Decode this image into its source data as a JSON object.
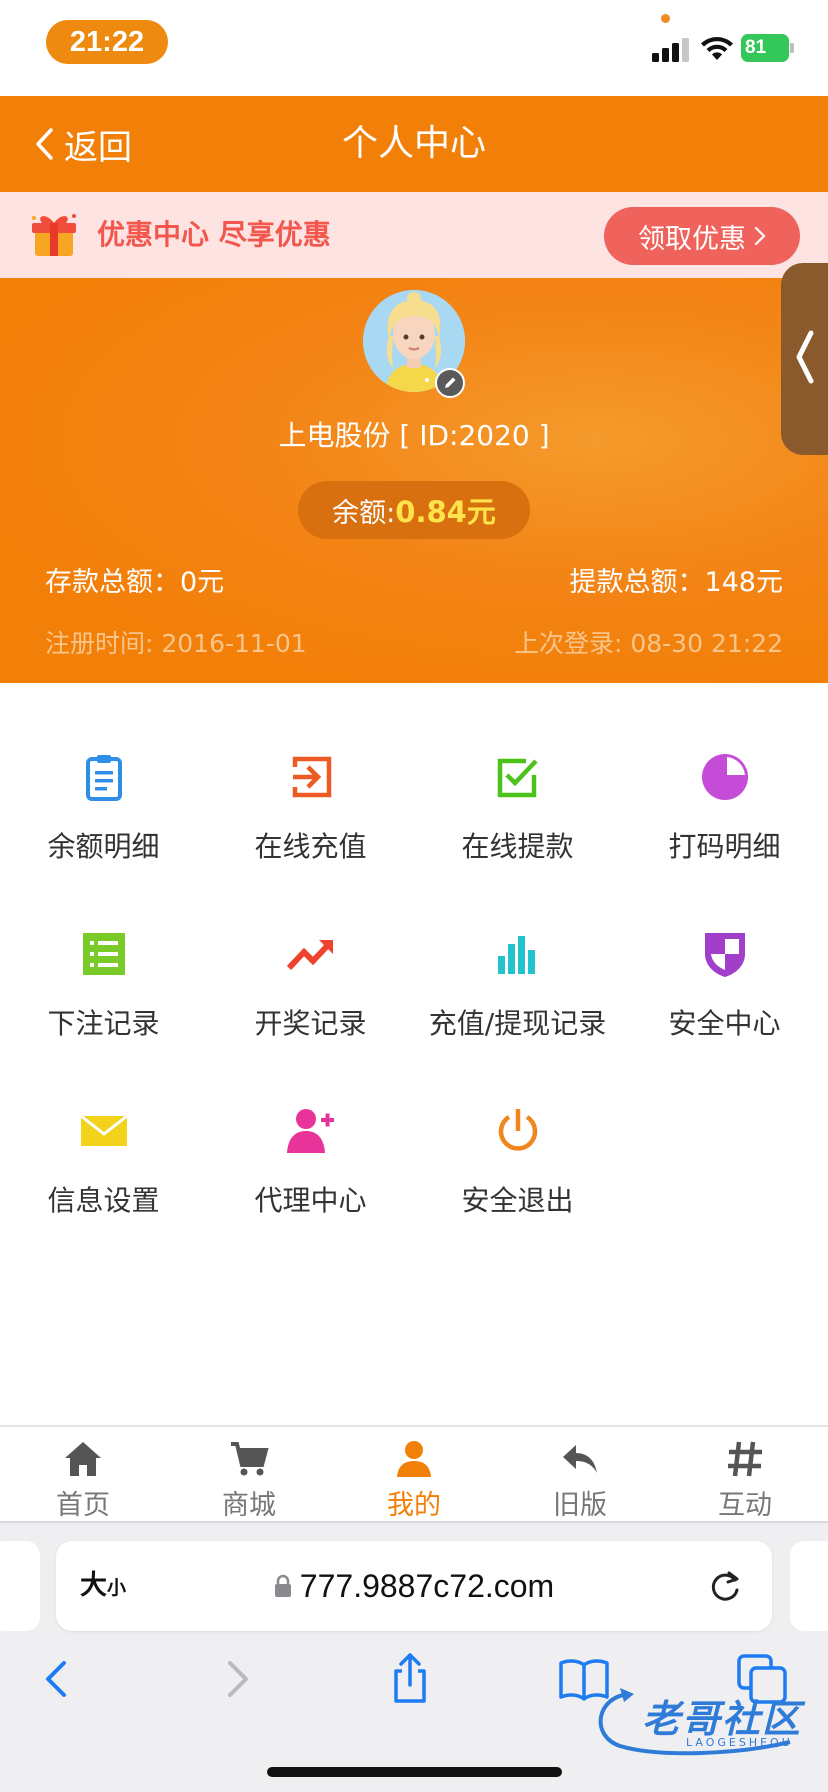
{
  "status": {
    "time": "21:22",
    "battery": "81"
  },
  "header": {
    "back_label": "返回",
    "title": "个人中心"
  },
  "promo": {
    "text": "优惠中心 尽享优惠",
    "button": "领取优惠"
  },
  "profile": {
    "name": "上电股份 [ ID:2020 ]",
    "balance_label": "余额: ",
    "balance_value": "0.84元",
    "deposit": "存款总额：0元",
    "withdraw": "提款总额：148元",
    "register": "注册时间: 2016-11-01",
    "last_login": "上次登录: 08-30 21:22"
  },
  "menu": [
    {
      "label": "余额明细",
      "icon": "clipboard-icon",
      "color": "#2F8FE8"
    },
    {
      "label": "在线充值",
      "icon": "login-arrow-icon",
      "color": "#EE5A24"
    },
    {
      "label": "在线提款",
      "icon": "checkbox-icon",
      "color": "#4CC21B"
    },
    {
      "label": "打码明细",
      "icon": "pie-chart-icon",
      "color": "#C54CD6"
    },
    {
      "label": "下注记录",
      "icon": "list-icon",
      "color": "#7ACB2A"
    },
    {
      "label": "开奖记录",
      "icon": "trend-up-icon",
      "color": "#F0432F"
    },
    {
      "label": "充值/提现记录",
      "icon": "bar-chart-icon",
      "color": "#22C3CC"
    },
    {
      "label": "安全中心",
      "icon": "shield-icon",
      "color": "#A13FCB"
    },
    {
      "label": "信息设置",
      "icon": "envelope-icon",
      "color": "#F2D21A"
    },
    {
      "label": "代理中心",
      "icon": "add-user-icon",
      "color": "#E8339A"
    },
    {
      "label": "安全退出",
      "icon": "power-icon",
      "color": "#F0861E"
    }
  ],
  "tabs": [
    {
      "label": "首页",
      "icon": "home-icon"
    },
    {
      "label": "商城",
      "icon": "cart-icon"
    },
    {
      "label": "我的",
      "icon": "user-icon",
      "active": true
    },
    {
      "label": "旧版",
      "icon": "reply-icon"
    },
    {
      "label": "互动",
      "icon": "hashtag-icon"
    }
  ],
  "browser": {
    "text_size": "大",
    "text_size_small": "小",
    "url": "777.9887c72.com"
  },
  "watermark": {
    "text": "老哥社区",
    "sub": "LAOGESHEQU"
  },
  "colors": {
    "brand_orange": "#F27F08",
    "promo_red": "#F2574D",
    "balance_yellow": "#FFE34A"
  }
}
